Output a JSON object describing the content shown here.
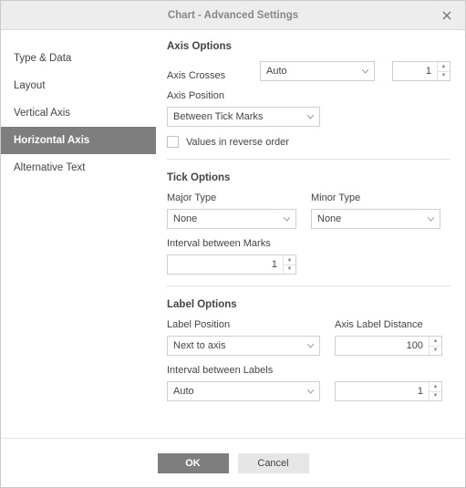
{
  "dialog": {
    "title": "Chart - Advanced Settings"
  },
  "sidebar": {
    "items": [
      {
        "label": "Type & Data"
      },
      {
        "label": "Layout"
      },
      {
        "label": "Vertical Axis"
      },
      {
        "label": "Horizontal Axis"
      },
      {
        "label": "Alternative Text"
      }
    ]
  },
  "axisOptions": {
    "title": "Axis Options",
    "crossesLabel": "Axis Crosses",
    "crossesValue": "Auto",
    "crossesNumber": "1",
    "positionLabel": "Axis Position",
    "positionValue": "Between Tick Marks",
    "reverseLabel": "Values in reverse order"
  },
  "tickOptions": {
    "title": "Tick Options",
    "majorLabel": "Major Type",
    "majorValue": "None",
    "minorLabel": "Minor Type",
    "minorValue": "None",
    "intervalLabel": "Interval between Marks",
    "intervalValue": "1"
  },
  "labelOptions": {
    "title": "Label Options",
    "posLabel": "Label Position",
    "posValue": "Next to axis",
    "distLabel": "Axis Label Distance",
    "distValue": "100",
    "intervalLabel": "Interval between Labels",
    "intervalSelect": "Auto",
    "intervalValue": "1"
  },
  "buttons": {
    "ok": "OK",
    "cancel": "Cancel"
  }
}
